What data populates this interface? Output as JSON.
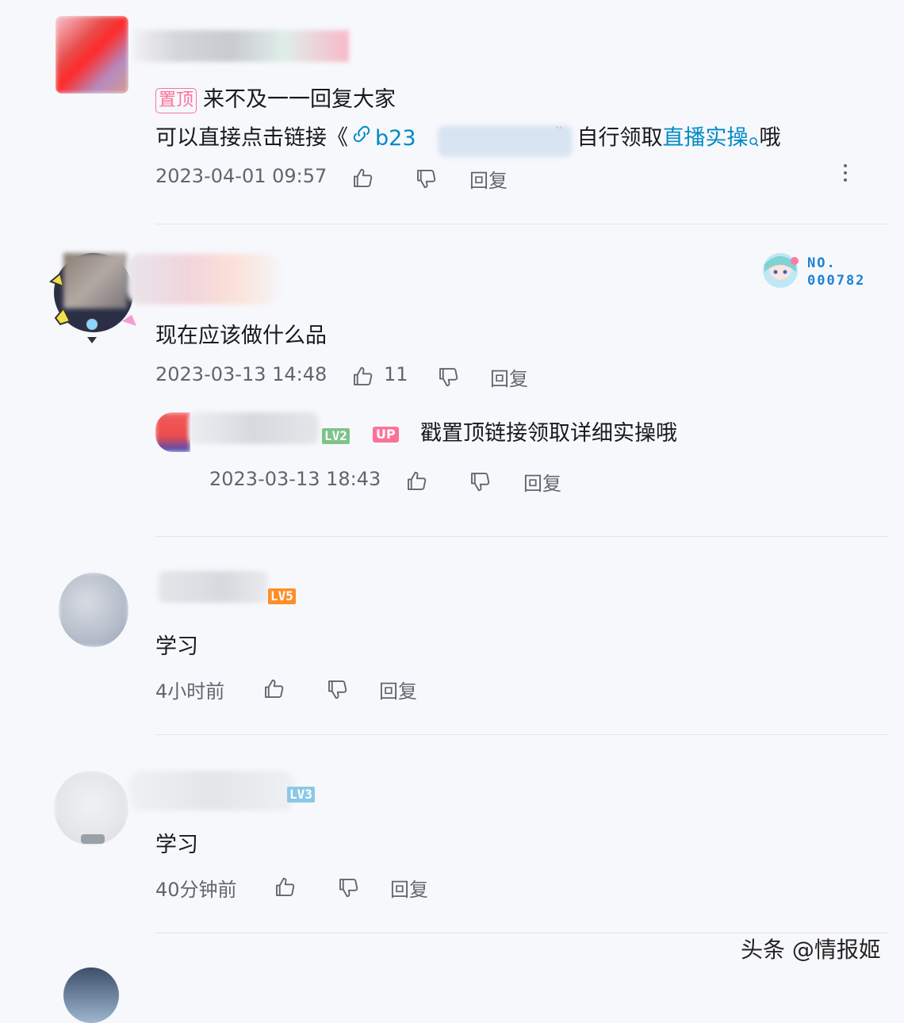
{
  "comments": [
    {
      "pinned_label": "置顶",
      "text_line1": "来不及一一回复大家",
      "text_line2_prefix": "可以直接点击链接《",
      "link_text": "b23",
      "text_line2_mid": "》自行领取",
      "keyword_text": "直播实操",
      "text_line2_suffix": "哦",
      "time": "2023-04-01 09:57",
      "like_count": "",
      "reply_label": "回复"
    },
    {
      "badge_no_label": "NO.",
      "badge_no_value": "000782",
      "text": "现在应该做什么品",
      "time": "2023-03-13 14:48",
      "like_count": "11",
      "reply_label": "回复",
      "reply": {
        "level_label": "LV2",
        "up_label": "UP",
        "text": "戳置顶链接领取详细实操哦",
        "time": "2023-03-13 18:43",
        "reply_label": "回复"
      }
    },
    {
      "level_label": "LV5",
      "text": "学习",
      "time": "4小时前",
      "reply_label": "回复"
    },
    {
      "level_label": "LV3",
      "text": "学习",
      "time": "40分钟前",
      "reply_label": "回复"
    }
  ],
  "watermark": "头条 @情报姬",
  "colors": {
    "accent_pink": "#fb7299",
    "link_blue": "#008ac5",
    "text_gray": "#61666d",
    "divider": "#e3e5e7"
  },
  "icons": {
    "like": "thumbs-up-icon",
    "dislike": "thumbs-down-icon",
    "link": "link-icon",
    "search": "search-icon",
    "more": "kebab-menu-icon"
  }
}
